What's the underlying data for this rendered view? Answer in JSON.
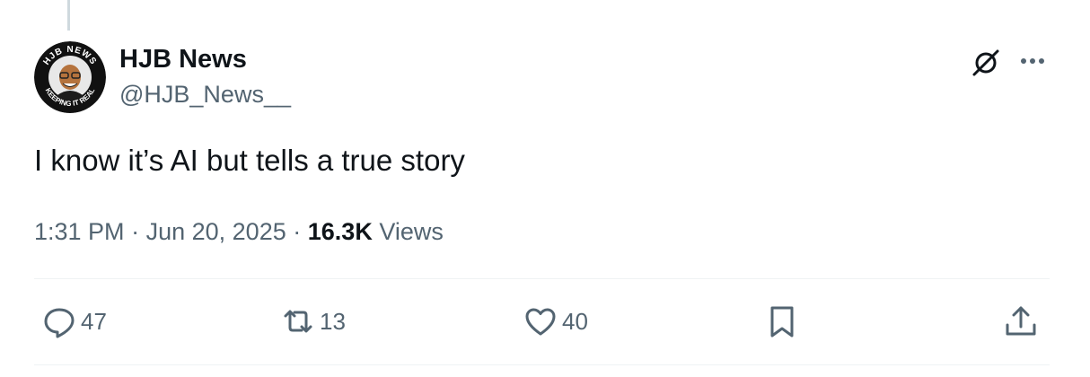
{
  "author": {
    "display_name": "HJB News",
    "handle": "@HJB_News__",
    "avatar_text": {
      "top": "HJB NEWS",
      "bottom": "KEEPING IT REAL"
    }
  },
  "tweet": {
    "text": "I know it’s AI but tells a true story",
    "time": "1:31 PM",
    "separator": "·",
    "date": "Jun 20, 2025",
    "views_count": "16.3K",
    "views_label": "Views"
  },
  "actions": {
    "replies": "47",
    "reposts": "13",
    "likes": "40"
  },
  "icons": {
    "grok": "grok-icon",
    "more": "more-dots-icon",
    "reply": "reply-icon",
    "repost": "repost-icon",
    "like": "heart-icon",
    "bookmark": "bookmark-icon",
    "share": "share-icon"
  },
  "colors": {
    "text_primary": "#0f1419",
    "text_secondary": "#536471",
    "divider": "#eff3f4",
    "thread_line": "#cfd9de"
  }
}
